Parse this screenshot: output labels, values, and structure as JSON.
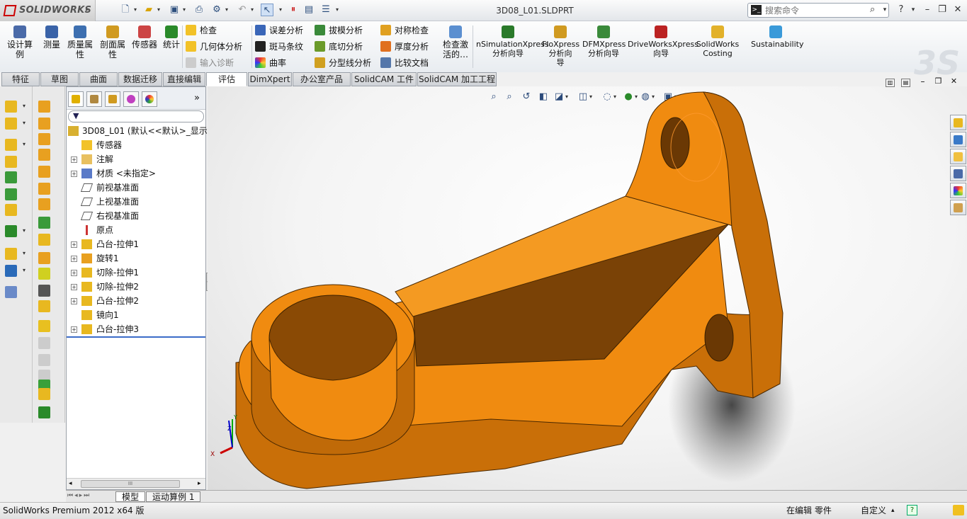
{
  "app": {
    "brand": "SOLIDWORKS",
    "document_title": "3D08_L01.SLDPRT",
    "search_placeholder": "搜索命令",
    "help_label": "?"
  },
  "quick_access": [
    {
      "icon": "new-document-icon"
    },
    {
      "icon": "open-folder-icon"
    },
    {
      "icon": "save-icon"
    },
    {
      "icon": "print-icon"
    },
    {
      "icon": "undo-icon"
    },
    {
      "icon": "select-cursor-icon"
    },
    {
      "icon": "rebuild-traffic-light-icon"
    },
    {
      "icon": "file-properties-icon"
    },
    {
      "icon": "options-icon"
    }
  ],
  "ribbon": {
    "big_buttons": [
      {
        "label": "设计算\n例",
        "icon": "design-study-icon",
        "color": "#4a6aa8"
      },
      {
        "label": "测量",
        "icon": "measure-icon",
        "color": "#3a63a8"
      },
      {
        "label": "质量属\n性",
        "icon": "mass-properties-icon",
        "color": "#3d6fb0"
      },
      {
        "label": "剖面属\n性",
        "icon": "section-properties-icon",
        "color": "#d09a20"
      },
      {
        "label": "传感器",
        "icon": "sensor-icon",
        "color": "#c44"
      },
      {
        "label": "统计",
        "icon": "statistics-icon",
        "color": "#2a8a2a"
      }
    ],
    "check_items": [
      {
        "label": "检查",
        "icon": "check-icon",
        "disabled": false
      },
      {
        "label": "几何体分析",
        "icon": "geometry-analysis-icon",
        "disabled": false
      },
      {
        "label": "输入诊断",
        "icon": "import-diagnostics-icon",
        "disabled": true
      }
    ],
    "analysis_col1": [
      {
        "label": "误差分析",
        "icon": "deviation-analysis-icon"
      },
      {
        "label": "斑马条纹",
        "icon": "zebra-stripes-icon"
      },
      {
        "label": "曲率",
        "icon": "curvature-icon"
      }
    ],
    "analysis_col2": [
      {
        "label": "拔模分析",
        "icon": "draft-analysis-icon"
      },
      {
        "label": "底切分析",
        "icon": "undercut-analysis-icon"
      },
      {
        "label": "分型线分析",
        "icon": "parting-line-analysis-icon"
      }
    ],
    "analysis_col3": [
      {
        "label": "对称检查",
        "icon": "symmetry-check-icon"
      },
      {
        "label": "厚度分析",
        "icon": "thickness-analysis-icon"
      },
      {
        "label": "比较文档",
        "icon": "compare-documents-icon"
      }
    ],
    "check_active": "检查激\n活的…",
    "xpress": [
      {
        "label": "nSimulationXpress\n分析向导",
        "icon": "simulationxpress-icon",
        "color": "#2a7a2a"
      },
      {
        "label": "FloXpress\n分析向\n导",
        "icon": "floxpress-icon",
        "color": "#d09a20"
      },
      {
        "label": "DFMXpress\n分析向导",
        "icon": "dfmxpress-icon",
        "color": "#3a8a3a"
      },
      {
        "label": "DriveWorksXpress\n向导",
        "icon": "driveworksxpress-icon",
        "color": "#b22"
      },
      {
        "label": "SolidWorks\nCosting",
        "icon": "costing-icon",
        "color": "#e2b12a"
      },
      {
        "label": "Sustainability",
        "icon": "sustainability-icon",
        "color": "#3a9ad9"
      }
    ]
  },
  "tabs": [
    "特征",
    "草图",
    "曲面",
    "数据迁移",
    "直接编辑",
    "评估",
    "DimXpert",
    "办公室产品",
    "SolidCAM 工件",
    "SolidCAM 加工工程"
  ],
  "active_tab": "评估",
  "feature_tree": {
    "root": "3D08_L01  (默认<<默认>_显示",
    "nodes": [
      {
        "label": "传感器",
        "icon": "sensors-folder-icon",
        "expandable": false
      },
      {
        "label": "注解",
        "icon": "annotations-icon",
        "expandable": true
      },
      {
        "label": "材质 <未指定>",
        "icon": "material-icon",
        "expandable": true
      },
      {
        "label": "前视基准面",
        "icon": "plane-icon",
        "expandable": false
      },
      {
        "label": "上视基准面",
        "icon": "plane-icon",
        "expandable": false
      },
      {
        "label": "右视基准面",
        "icon": "plane-icon",
        "expandable": false
      },
      {
        "label": "原点",
        "icon": "origin-icon",
        "expandable": false
      },
      {
        "label": "凸台-拉伸1",
        "icon": "boss-extrude-icon",
        "expandable": true
      },
      {
        "label": "旋转1",
        "icon": "revolve-icon",
        "expandable": true
      },
      {
        "label": "切除-拉伸1",
        "icon": "cut-extrude-icon",
        "expandable": true
      },
      {
        "label": "切除-拉伸2",
        "icon": "cut-extrude-icon",
        "expandable": true
      },
      {
        "label": "凸台-拉伸2",
        "icon": "boss-extrude-icon",
        "expandable": true
      },
      {
        "label": "镜向1",
        "icon": "mirror-icon",
        "expandable": false
      },
      {
        "label": "凸台-拉伸3",
        "icon": "boss-extrude-icon",
        "expandable": true
      }
    ],
    "scroll_thumb": "III"
  },
  "bottom_tabs": [
    "模型",
    "运动算例 1"
  ],
  "status": {
    "product": "SolidWorks Premium 2012 x64 版",
    "mode": "在编辑 零件",
    "units": "自定义"
  },
  "triad_labels": {
    "x": "X",
    "y": "Y",
    "z": "Z"
  },
  "colors": {
    "part": "#f08b10",
    "part_dark": "#8a4a05",
    "part_mid": "#c66d08",
    "accent": "#e8e8e8"
  }
}
